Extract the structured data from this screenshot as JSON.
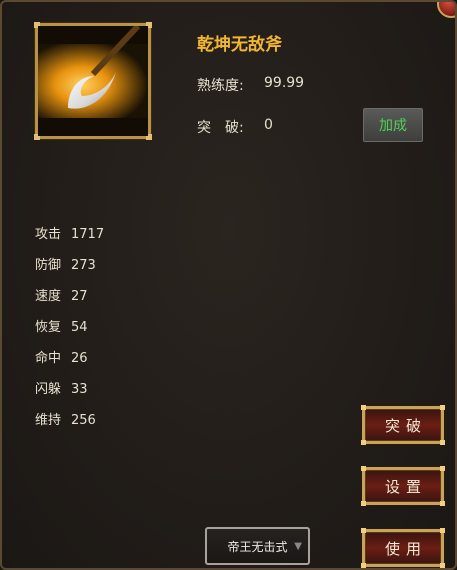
{
  "item": {
    "title": "乾坤无敌斧",
    "proficiency_label": "熟练度:",
    "proficiency_value": "99.99",
    "breakthrough_label": "突　破:",
    "breakthrough_value": "0",
    "boost_label": "加成",
    "icon": "golden-axe-icon"
  },
  "stats": [
    {
      "label": "攻击",
      "value": "1717"
    },
    {
      "label": "防御",
      "value": "273"
    },
    {
      "label": "速度",
      "value": "27"
    },
    {
      "label": "恢复",
      "value": "54"
    },
    {
      "label": "命中",
      "value": "26"
    },
    {
      "label": "闪躲",
      "value": "33"
    },
    {
      "label": "维持",
      "value": "256"
    }
  ],
  "actions": {
    "breakthrough": "突破",
    "settings": "设置",
    "use": "使用"
  },
  "skill_select": {
    "value": "帝王无击式"
  },
  "colors": {
    "title": "#f2b632",
    "boost_text": "#4fd05a",
    "frame_gold": "#b89248",
    "button_red": "#6a1e14"
  }
}
